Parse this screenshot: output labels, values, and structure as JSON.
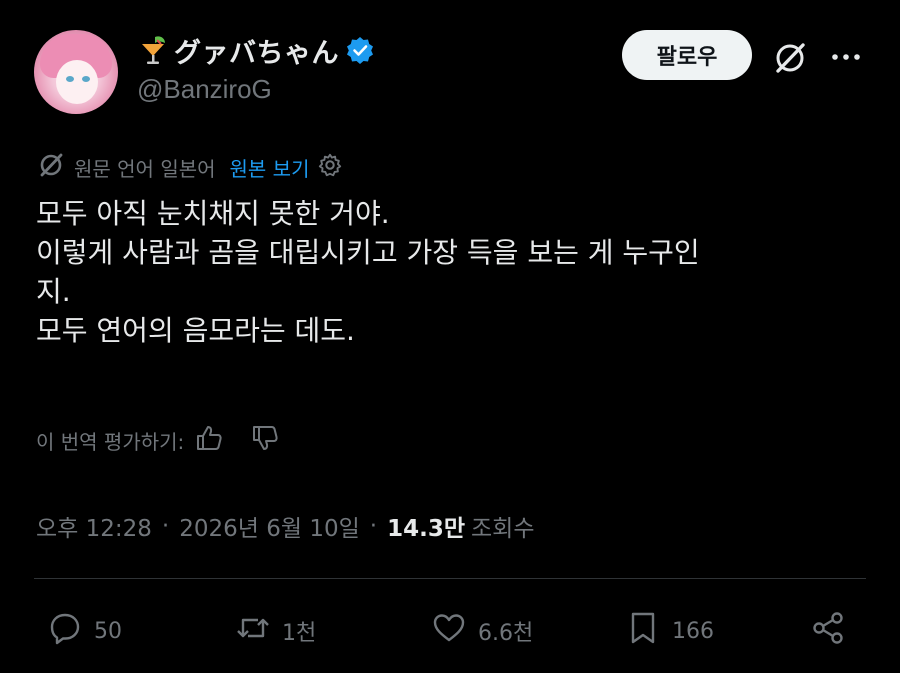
{
  "author": {
    "display_name": "グァバちゃん",
    "handle": "@BanziroG",
    "verified": true,
    "name_emoji": "tropical-drink-icon"
  },
  "header": {
    "follow_label": "팔로우"
  },
  "translation": {
    "label": "원문 언어 일본어",
    "show_original": "원본 보기"
  },
  "tweet": {
    "lines": [
      "모두 아직 눈치채지 못한 거야.",
      "이렇게 사람과 곰을 대립시키고 가장 득을 보는 게 누구인",
      "지.",
      "모두 연어의 음모라는 데도."
    ]
  },
  "rate": {
    "label": "이 번역 평가하기:"
  },
  "meta": {
    "time": "오후 12:28",
    "date": "2026년 6월 10일",
    "views_count": "14.3만",
    "views_label": "조회수"
  },
  "actions": {
    "replies": "50",
    "reposts": "1천",
    "likes": "6.6천",
    "bookmarks": "166"
  },
  "colors": {
    "background": "#000000",
    "text": "#e7e9ea",
    "muted": "#71767b",
    "accent": "#1d9bf0",
    "divider": "#2f3336"
  }
}
